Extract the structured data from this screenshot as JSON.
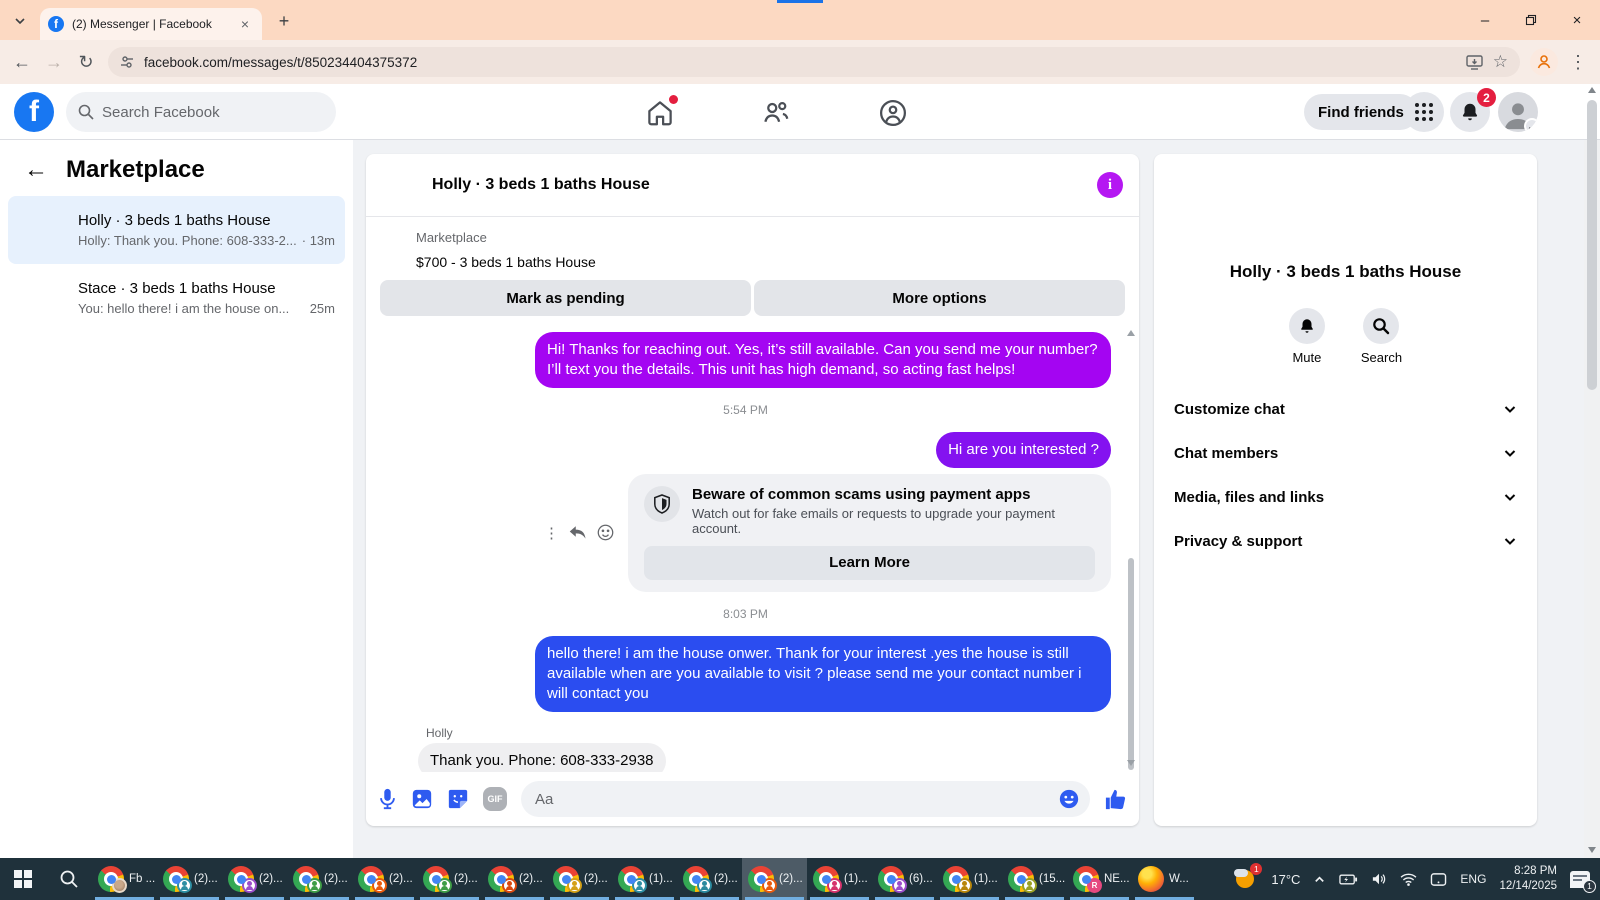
{
  "browser": {
    "tab_title": "(2) Messenger | Facebook",
    "url": "facebook.com/messages/t/850234404375372"
  },
  "icons": {
    "back_arrow": "←",
    "forward_arrow": "→",
    "reload": "↻",
    "bookmark_star": "☆",
    "overflow_dots": "⋮",
    "close_x": "×",
    "minimize": "–",
    "new_tab_plus": "+",
    "info_i": "i",
    "actions_dots": "⋮",
    "sidebar_back": "←"
  },
  "header": {
    "search_placeholder": "Search Facebook",
    "find_friends_label": "Find friends",
    "notification_badge": "2"
  },
  "sidebar": {
    "title": "Marketplace",
    "conversations": [
      {
        "title": "Holly · 3 beds 1 baths House",
        "preview": "Holly: Thank you. Phone: 608-333-2...",
        "time": "· 13m"
      },
      {
        "title": "Stace · 3 beds 1 baths House",
        "preview": "You: hello there! i am the house on...",
        "time": "25m"
      }
    ]
  },
  "chat": {
    "title": "Holly · 3 beds 1 baths House",
    "marketplace_label": "Marketplace",
    "listing": "$700 - 3 beds 1 baths House",
    "mark_pending_label": "Mark as pending",
    "more_options_label": "More options",
    "timestamp1": "5:54 PM",
    "timestamp2": "8:03 PM",
    "msg_outgoing_1": "Hi! Thanks for reaching out. Yes, it’s still available. Can you send me your number? I’ll text you the details. This unit has high demand, so acting fast helps!",
    "msg_outgoing_2": "Hi are you interested ?",
    "scam_warning": {
      "title": "Beware of common scams using payment apps",
      "body": "Watch out for fake emails or requests to upgrade your payment account.",
      "button_label": "Learn More"
    },
    "msg_outgoing_3": "hello there! i am the house onwer. Thank  for your interest .yes the house is still available when are you available to visit ? please send me your contact number i will contact you",
    "incoming_sender": "Holly",
    "msg_incoming_1": "Thank you. Phone: 608-333-2938",
    "composer_placeholder": "Aa",
    "gif_label": "GIF"
  },
  "details_panel": {
    "title": "Holly · 3 beds 1 baths House",
    "mute_label": "Mute",
    "search_label": "Search",
    "sections": [
      "Customize chat",
      "Chat members",
      "Media, files and links",
      "Privacy & support"
    ]
  },
  "taskbar": {
    "items": [
      {
        "label": "Fb ...",
        "type": "chrome",
        "photo": true
      },
      {
        "label": "(2)...",
        "type": "chrome",
        "badge": "#2e8fa3"
      },
      {
        "label": "(2)...",
        "type": "chrome",
        "badge": "#9b4dca"
      },
      {
        "label": "(2)...",
        "type": "chrome",
        "badge": "#3f9d46"
      },
      {
        "label": "(2)...",
        "type": "chrome",
        "badge": "#e8590c"
      },
      {
        "label": "(2)...",
        "type": "chrome",
        "badge": "#3f9d46"
      },
      {
        "label": "(2)...",
        "type": "chrome",
        "badge": "#d9480f"
      },
      {
        "label": "(2)...",
        "type": "chrome",
        "badge": "#d4a017"
      },
      {
        "label": "(1)...",
        "type": "chrome",
        "badge": "#2e8fa3"
      },
      {
        "label": "(2)...",
        "type": "chrome",
        "badge": "#2b8a9e"
      },
      {
        "label": "(2)...",
        "type": "chrome",
        "badge": "#e8590c",
        "active": true
      },
      {
        "label": "(1)...",
        "type": "chrome",
        "badge": "#d6336c"
      },
      {
        "label": "(6)...",
        "type": "chrome",
        "badge": "#9b4dca"
      },
      {
        "label": "(1)...",
        "type": "chrome",
        "badge": "#b8860b"
      },
      {
        "label": "(15...",
        "type": "chrome",
        "badge": "#9aa024"
      },
      {
        "label": "NE...",
        "type": "chrome",
        "badge": "#e64980",
        "letter": "R"
      },
      {
        "label": "W...",
        "type": "firefox"
      }
    ],
    "tray": {
      "weather_badge": "1",
      "temperature": "17°C",
      "language": "ENG",
      "time": "8:28 PM",
      "date": "12/14/2025",
      "notification_badge": "1"
    }
  }
}
